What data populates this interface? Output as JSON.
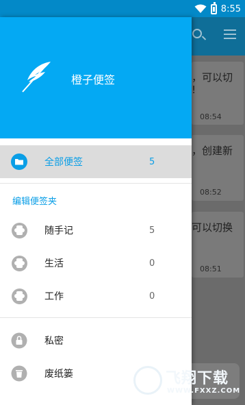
{
  "status_bar": {
    "time": "8:55"
  },
  "app": {
    "title": "橙子便签"
  },
  "nav": {
    "all_notes": {
      "label": "全部便签",
      "count": "5"
    },
    "section_title": "编辑便签夹",
    "folders": [
      {
        "label": "随手记",
        "count": "5"
      },
      {
        "label": "生活",
        "count": "0"
      },
      {
        "label": "工作",
        "count": "0"
      }
    ],
    "private": {
      "label": "私密"
    },
    "trash": {
      "label": "废纸篓"
    }
  },
  "background_notes": [
    {
      "line1": "，可以切",
      "line2": "!",
      "time": "08:54"
    },
    {
      "line1": "，创建新",
      "line2": "",
      "time": "08:52"
    },
    {
      "line1": "可以切换",
      "line2": "",
      "time": "08:51"
    }
  ],
  "watermark": {
    "brand": "飞翔下载",
    "url": "WWW.FXXZ.COM"
  },
  "colors": {
    "header": "#04a9f3",
    "accent": "#0a9ee6",
    "status_bar": "#0389c8"
  }
}
